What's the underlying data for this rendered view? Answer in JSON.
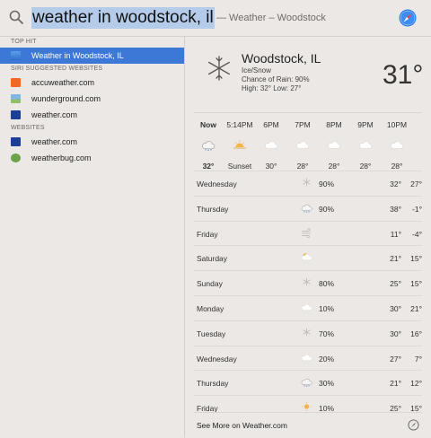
{
  "search": {
    "query": "weather in woodstock, il",
    "completion_hint": " — Weather – Woodstock"
  },
  "sidebar": {
    "sections": [
      {
        "title": "TOP HIT",
        "items": [
          {
            "label": "Weather in Woodstock, IL",
            "icon": "weather-app-icon",
            "selected": true
          }
        ]
      },
      {
        "title": "SIRI SUGGESTED WEBSITES",
        "items": [
          {
            "label": "accuweather.com",
            "icon": "accuweather-favicon"
          },
          {
            "label": "wunderground.com",
            "icon": "wunderground-favicon"
          },
          {
            "label": "weather.com",
            "icon": "weather-com-favicon"
          }
        ]
      },
      {
        "title": "WEBSITES",
        "items": [
          {
            "label": "weather.com",
            "icon": "weather-com-favicon"
          },
          {
            "label": "weatherbug.com",
            "icon": "weatherbug-favicon"
          }
        ]
      }
    ]
  },
  "weather": {
    "city": "Woodstock, IL",
    "condition": "Ice/Snow",
    "chance": "Chance of Rain: 90%",
    "hilo": "High: 32° Low: 27°",
    "current_temp": "31°",
    "hourly": [
      {
        "time": "Now",
        "icon": "ice-snow-icon",
        "temp": "32°"
      },
      {
        "time": "5:14PM",
        "icon": "sunset-icon",
        "temp": "Sunset"
      },
      {
        "time": "6PM",
        "icon": "cloud-icon",
        "temp": "30°"
      },
      {
        "time": "7PM",
        "icon": "cloud-icon",
        "temp": "28°"
      },
      {
        "time": "8PM",
        "icon": "cloud-icon",
        "temp": "28°"
      },
      {
        "time": "9PM",
        "icon": "cloud-icon",
        "temp": "28°"
      },
      {
        "time": "10PM",
        "icon": "cloud-icon",
        "temp": "28°"
      }
    ],
    "daily": [
      {
        "day": "Wednesday",
        "icon": "snow-icon",
        "chance": "90%",
        "high": "32°",
        "low": "27°"
      },
      {
        "day": "Thursday",
        "icon": "ice-snow-icon",
        "chance": "90%",
        "high": "38°",
        "low": "-1°"
      },
      {
        "day": "Friday",
        "icon": "wind-icon",
        "chance": "",
        "high": "11°",
        "low": "-4°"
      },
      {
        "day": "Saturday",
        "icon": "partly-sunny-icon",
        "chance": "",
        "high": "21°",
        "low": "15°"
      },
      {
        "day": "Sunday",
        "icon": "snow-icon",
        "chance": "80%",
        "high": "25°",
        "low": "15°"
      },
      {
        "day": "Monday",
        "icon": "cloud-icon",
        "chance": "10%",
        "high": "30°",
        "low": "21°"
      },
      {
        "day": "Tuesday",
        "icon": "snow-icon",
        "chance": "70%",
        "high": "30°",
        "low": "16°"
      },
      {
        "day": "Wednesday",
        "icon": "cloud-icon",
        "chance": "20%",
        "high": "27°",
        "low": "7°"
      },
      {
        "day": "Thursday",
        "icon": "ice-snow-icon",
        "chance": "30%",
        "high": "21°",
        "low": "12°"
      },
      {
        "day": "Friday",
        "icon": "sun-icon",
        "chance": "10%",
        "high": "25°",
        "low": "15°"
      }
    ],
    "more_link": "See More on Weather.com"
  },
  "colors": {
    "selection": "#3d78d6",
    "query_highlight": "#b4cbea",
    "background": "#ebe8e5"
  }
}
